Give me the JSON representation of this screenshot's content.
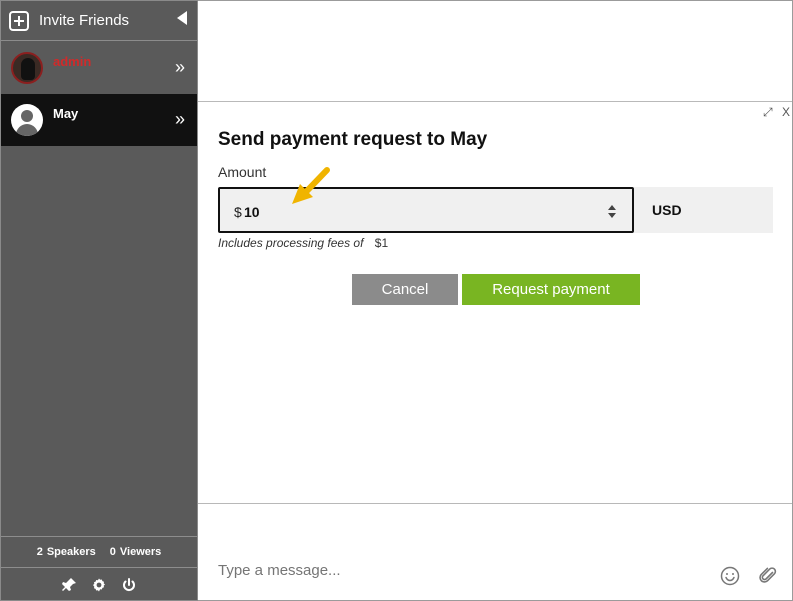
{
  "sidebar": {
    "invite_label": "Invite Friends",
    "users": [
      {
        "name": "admin",
        "name_color": "#d12a2a"
      },
      {
        "name": "May",
        "name_color": "#ffffff"
      }
    ],
    "stats": {
      "speakers_count": "2",
      "speakers_label": "Speakers",
      "viewers_count": "0",
      "viewers_label": "Viewers"
    }
  },
  "modal": {
    "close_label": "X",
    "title": "Send payment request to May",
    "amount_label": "Amount",
    "currency_symbol": "$",
    "amount_value": "10",
    "currency_code": "USD",
    "fees_label": "Includes processing fees of",
    "fees_value": "$1",
    "cancel_label": "Cancel",
    "request_label": "Request payment"
  },
  "composer": {
    "placeholder": "Type a message..."
  },
  "colors": {
    "sidebar_bg": "#5a5a5a",
    "selected_row_bg": "#111111",
    "cancel_bg": "#8b8b8b",
    "request_bg": "#79b522",
    "arrow_color": "#f0b400"
  },
  "icons": [
    "plus-icon",
    "collapse-icon",
    "chevron-right-icon",
    "pin-icon",
    "gear-icon",
    "power-icon",
    "expand-icon",
    "close-icon",
    "spinner-icon",
    "emoji-icon",
    "attach-icon",
    "annotation-arrow-icon"
  ]
}
